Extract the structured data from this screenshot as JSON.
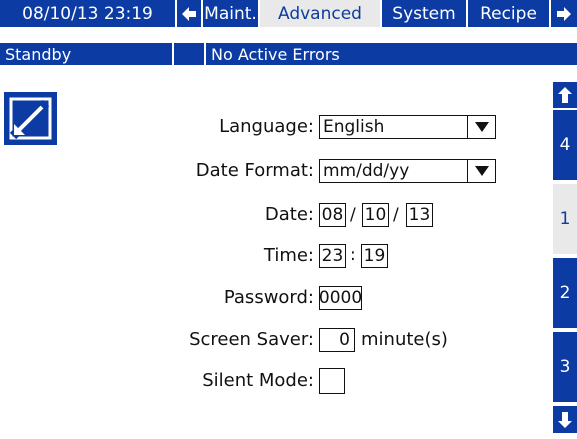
{
  "header": {
    "datetime": "08/10/13 23:19",
    "tabs": [
      {
        "label": "Maint."
      },
      {
        "label": "Advanced"
      },
      {
        "label": "System"
      },
      {
        "label": "Recipe"
      }
    ],
    "active_tab": "Advanced"
  },
  "status": {
    "mode": "Standby",
    "errors": "No Active Errors"
  },
  "form": {
    "language": {
      "label": "Language:",
      "value": "English"
    },
    "date_format": {
      "label": "Date Format:",
      "value": "mm/dd/yy"
    },
    "date": {
      "label": "Date:",
      "month": "08",
      "day": "10",
      "year": "13",
      "separator": "/"
    },
    "time": {
      "label": "Time:",
      "hour": "23",
      "minute": "19",
      "separator": ":"
    },
    "password": {
      "label": "Password:",
      "value": "0000"
    },
    "screen_saver": {
      "label": "Screen Saver:",
      "value": "0",
      "unit": "minute(s)"
    },
    "silent_mode": {
      "label": "Silent Mode:",
      "checked": false
    }
  },
  "sidebar": {
    "pages": [
      "4",
      "1",
      "2",
      "3"
    ],
    "active_page": "1"
  },
  "icons": {
    "edit": "edit-icon",
    "left": "arrow-left-icon",
    "right": "arrow-right-icon",
    "up": "arrow-up-icon",
    "down": "arrow-down-icon",
    "dropdown": "dropdown-triangle-icon"
  },
  "colors": {
    "bar_blue": "#0b3ba3",
    "active_tab_bg": "#e9e9e9"
  }
}
